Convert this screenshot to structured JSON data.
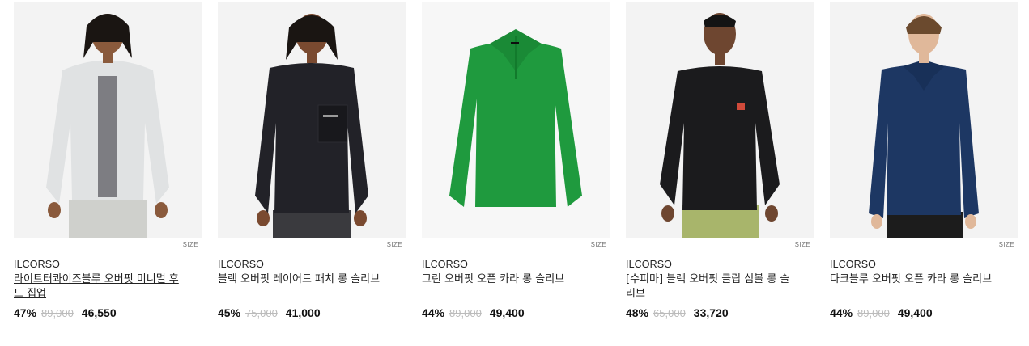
{
  "products": [
    {
      "brand": "ILCORSO",
      "name": "라이트터콰이즈블루 오버핏 미니멀 후드 집업",
      "discount": "47%",
      "original_price": "89,000",
      "sale_price": "46,550",
      "size_label": "SIZE",
      "colors": {
        "garment": "#e0e2e3",
        "inner": "#7d7d82",
        "pants": "#cfd0cc"
      }
    },
    {
      "brand": "ILCORSO",
      "name": "블랙 오버핏 레이어드 패치 롱 슬리브",
      "discount": "45%",
      "original_price": "75,000",
      "sale_price": "41,000",
      "size_label": "SIZE",
      "colors": {
        "garment": "#222228",
        "pants": "#3a3a3e"
      }
    },
    {
      "brand": "ILCORSO",
      "name": "그린 오버핏 오픈 카라 롱 슬리브",
      "discount": "44%",
      "original_price": "89,000",
      "sale_price": "49,400",
      "size_label": "SIZE",
      "colors": {
        "garment": "#1f9a3e"
      }
    },
    {
      "brand": "ILCORSO",
      "name": "[수피마] 블랙 오버핏 클립 심볼 롱 슬리브",
      "discount": "48%",
      "original_price": "65,000",
      "sale_price": "33,720",
      "size_label": "SIZE",
      "colors": {
        "garment": "#1b1b1d",
        "pants": "#a8b56b"
      }
    },
    {
      "brand": "ILCORSO",
      "name": "다크블루 오버핏 오픈 카라 롱 슬리브",
      "discount": "44%",
      "original_price": "89,000",
      "sale_price": "49,400",
      "size_label": "SIZE",
      "colors": {
        "garment": "#1d3763",
        "pants": "#1c1c1c"
      }
    }
  ]
}
